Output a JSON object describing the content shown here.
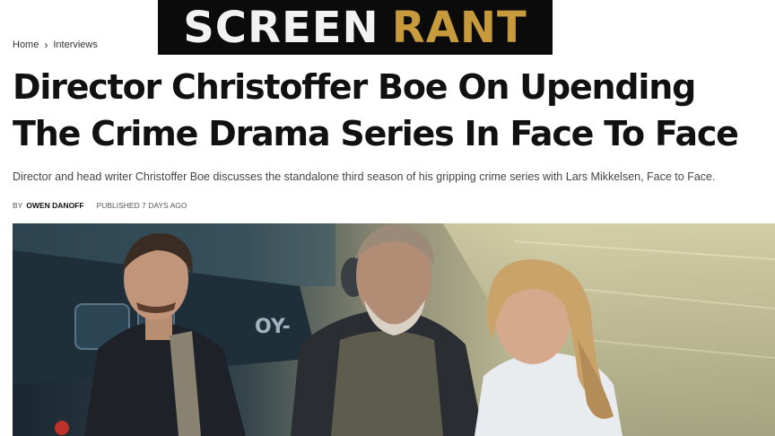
{
  "site": {
    "logo_part1": "SCREEN",
    "logo_part2": "RANT",
    "colors": {
      "logo_bg": "#0b0b0b",
      "logo_accent": "#c79a3b"
    }
  },
  "breadcrumb": {
    "home": "Home",
    "separator_icon": "chevron-right-icon",
    "section": "Interviews"
  },
  "article": {
    "title": "Director Christoffer Boe On Upending The Crime Drama Series In Face To Face",
    "dek": "Director and head writer Christoffer Boe discusses the standalone third season of his gripping crime series with Lars Mikkelsen, Face to Face.",
    "by_label": "BY",
    "author": "OWEN DANOFF",
    "published": "PUBLISHED 7 DAYS AGO"
  },
  "hero": {
    "overlay_text": "OY-"
  }
}
